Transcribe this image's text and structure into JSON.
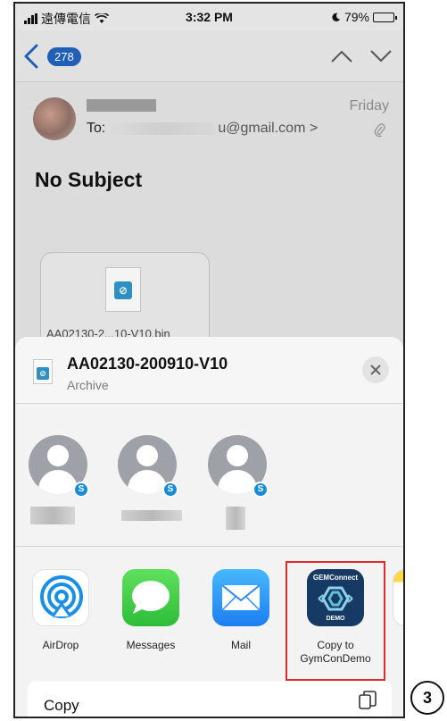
{
  "status_bar": {
    "carrier": "遠傳電信",
    "time": "3:32 PM",
    "battery": "79%"
  },
  "nav": {
    "back_count": "278"
  },
  "email": {
    "to_label": "To:",
    "to_suffix": "u@gmail.com >",
    "date": "Friday",
    "subject": "No Subject",
    "attachment_name": "AA02130-2...10-V10.bin"
  },
  "share_sheet": {
    "file_title": "AA02130-200910-V10",
    "file_subtitle": "Archive",
    "contacts": [
      {
        "badge": "S"
      },
      {
        "badge": "S"
      },
      {
        "badge": "S"
      }
    ],
    "apps": [
      {
        "label": "AirDrop"
      },
      {
        "label": "Messages"
      },
      {
        "label": "Mail"
      },
      {
        "label": "Copy to\nGymConDemo",
        "line1": "Copy to",
        "line2": "GymConDemo",
        "tile_top": "GEMConnect",
        "tile_bottom": "DEMO"
      }
    ],
    "copy_label": "Copy"
  },
  "step_label": "3",
  "colors": {
    "highlight": "#e12b2b",
    "badge_blue": "#1f5fb8",
    "gem_navy": "#173a64"
  }
}
